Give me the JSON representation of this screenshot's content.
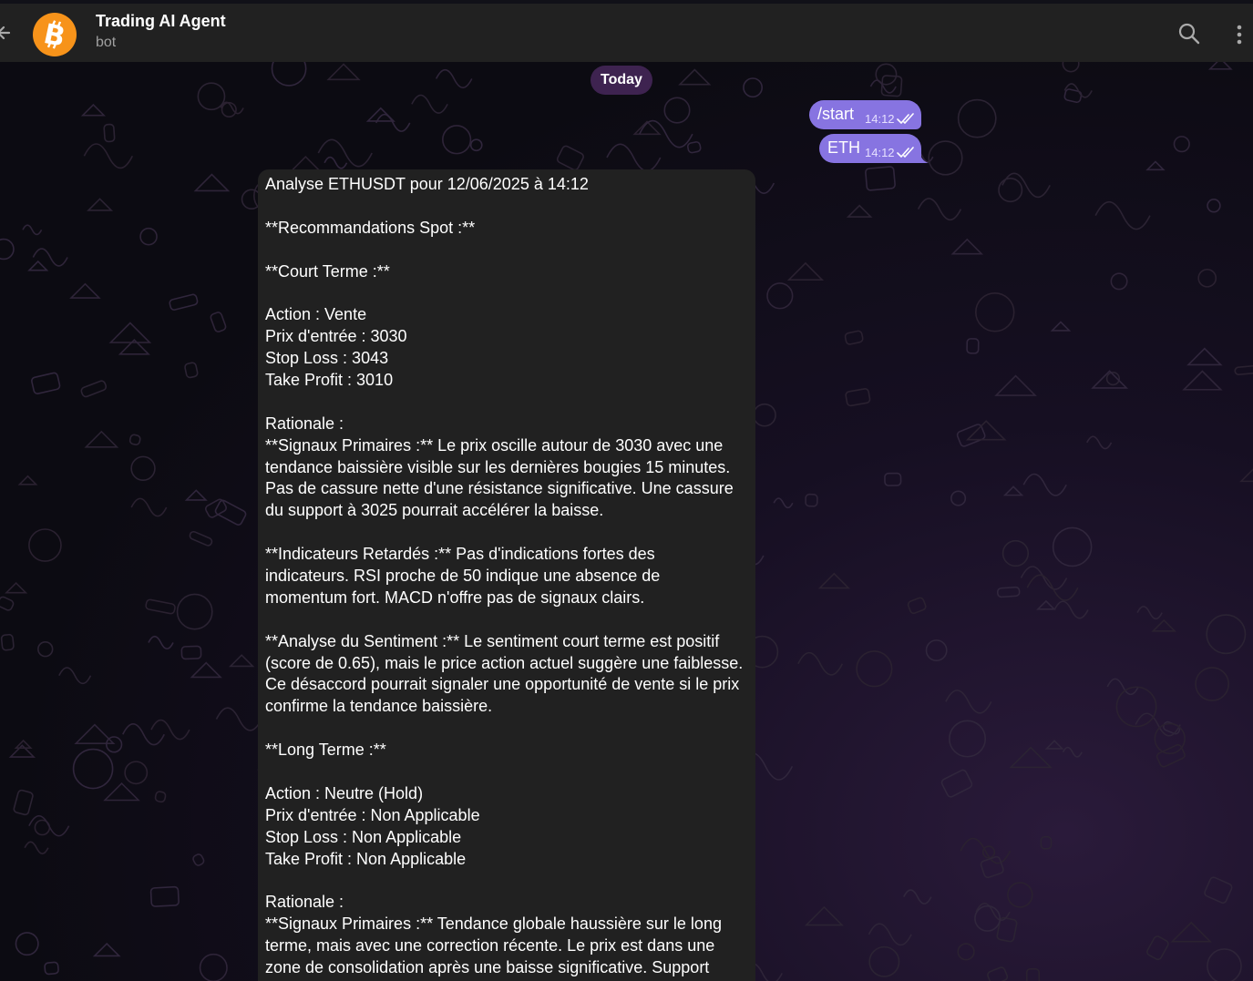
{
  "header": {
    "title": "Trading AI Agent",
    "subtitle": "bot",
    "avatar_icon": "bitcoin-icon",
    "avatar_color": "#f7931a"
  },
  "date_chip": "Today",
  "outgoing": [
    {
      "text": "/start",
      "time": "14:12",
      "status_icon": "double-check-icon"
    },
    {
      "text": "ETH",
      "time": "14:12",
      "status_icon": "double-check-icon"
    }
  ],
  "incoming": {
    "lines": [
      "Analyse ETHUSDT pour 12/06/2025 à 14:12",
      "",
      "**Recommandations Spot :**",
      "",
      "**Court Terme :**",
      "",
      "Action : Vente",
      "Prix d'entrée : 3030",
      "Stop Loss : 3043",
      "Take Profit : 3010",
      "",
      "Rationale :",
      "**Signaux Primaires :** Le prix oscille autour de 3030 avec une",
      "tendance baissière visible sur les dernières bougies 15 minutes.",
      "Pas de cassure nette d'une résistance significative. Une cassure",
      "du support à 3025 pourrait accélérer la baisse.",
      "",
      "**Indicateurs Retardés :** Pas d'indications fortes des",
      "indicateurs. RSI proche de 50 indique une absence de",
      "momentum fort. MACD n'offre pas de signaux clairs.",
      "",
      "**Analyse du Sentiment :** Le sentiment court terme est positif",
      "(score de 0.65), mais le price action actuel suggère une faiblesse.",
      "Ce désaccord pourrait signaler une opportunité de vente si le prix",
      "confirme la tendance baissière.",
      "",
      "**Long Terme :**",
      "",
      "Action : Neutre (Hold)",
      "Prix d'entrée : Non Applicable",
      "Stop Loss : Non Applicable",
      "Take Profit : Non Applicable",
      "",
      "Rationale :",
      "**Signaux Primaires :** Tendance globale haussière sur le long",
      "terme, mais avec une correction récente. Le prix est dans une",
      "zone de consolidation après une baisse significative. Support"
    ]
  },
  "colors": {
    "outgoing_bubble": "#8774e1",
    "incoming_bubble": "#212121",
    "header_bg": "#212121",
    "date_chip_bg": "#3e2350"
  }
}
